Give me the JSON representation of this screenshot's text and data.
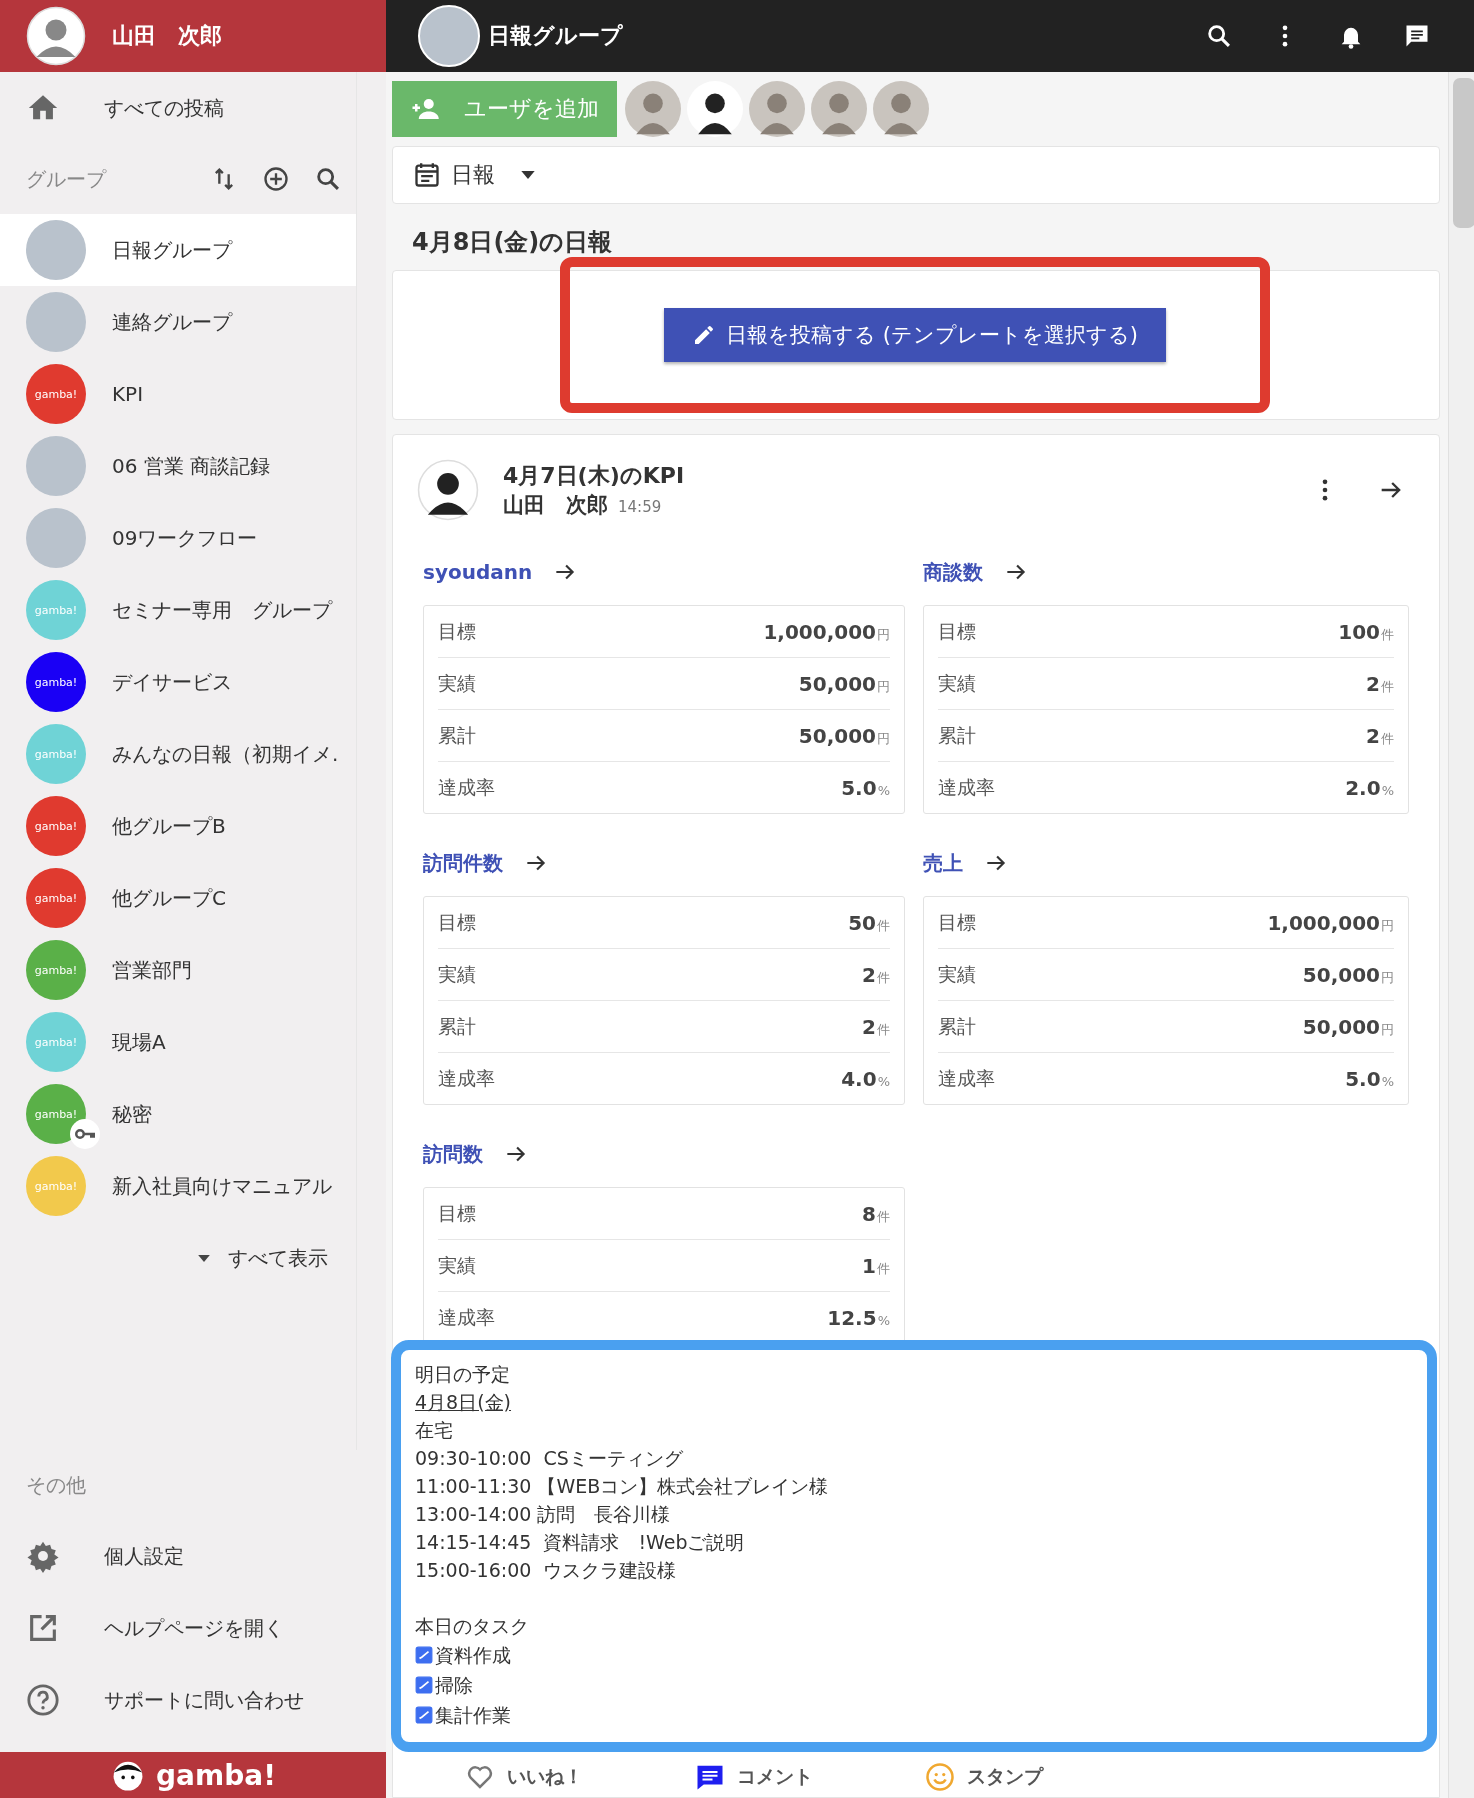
{
  "user": {
    "name": "山田　次郎"
  },
  "sidebar": {
    "all_posts": "すべての投稿",
    "groups_header": "グループ",
    "groups": [
      {
        "name": "日報グループ",
        "kind": "photo",
        "selected": true,
        "locked": false
      },
      {
        "name": "連絡グループ",
        "kind": "photo",
        "selected": false,
        "locked": false
      },
      {
        "name": "KPI",
        "kind": "logo",
        "logo": "gamba!",
        "color": "#e03a2f",
        "selected": false,
        "locked": false
      },
      {
        "name": "06 営業 商談記録",
        "kind": "photo",
        "selected": false,
        "locked": false
      },
      {
        "name": "09ワークフロー",
        "kind": "photo",
        "selected": false,
        "locked": false
      },
      {
        "name": "セミナー専用　グループ",
        "kind": "logo",
        "logo": "gamba!",
        "color": "#6fd3d6",
        "selected": false,
        "locked": false
      },
      {
        "name": "デイサービス",
        "kind": "logo",
        "logo": "gamba!",
        "color": "#1a00f5",
        "selected": false,
        "locked": false
      },
      {
        "name": "みんなの日報（初期イメ.",
        "kind": "logo",
        "logo": "gamba!",
        "color": "#6fd3d6",
        "selected": false,
        "locked": false
      },
      {
        "name": "他グループB",
        "kind": "logo",
        "logo": "gamba!",
        "color": "#e03a2f",
        "selected": false,
        "locked": false
      },
      {
        "name": "他グループC",
        "kind": "logo",
        "logo": "gamba!",
        "color": "#e03a2f",
        "selected": false,
        "locked": false
      },
      {
        "name": "営業部門",
        "kind": "logo",
        "logo": "gamba!",
        "color": "#5ab048",
        "selected": false,
        "locked": false
      },
      {
        "name": "現場A",
        "kind": "logo",
        "logo": "gamba!",
        "color": "#6fd3d6",
        "selected": false,
        "locked": false
      },
      {
        "name": "秘密",
        "kind": "logo",
        "logo": "gamba!",
        "color": "#5ab048",
        "selected": false,
        "locked": true
      },
      {
        "name": "新入社員向けマニュアル",
        "kind": "logo",
        "logo": "gamba!",
        "color": "#f2c94c",
        "selected": false,
        "locked": false
      }
    ],
    "show_all": "すべて表示",
    "other_header": "その他",
    "other_items": [
      {
        "label": "個人設定",
        "kind": "settings"
      },
      {
        "label": "ヘルプページを開く",
        "kind": "external"
      },
      {
        "label": "サポートに問い合わせ",
        "kind": "help"
      }
    ],
    "brand": "gamba!"
  },
  "topbar": {
    "title": "日報グループ"
  },
  "members": {
    "add_button": "ユーザを追加",
    "avatars": [
      {
        "kind": "photo"
      },
      {
        "kind": "cartoon"
      },
      {
        "kind": "photo"
      },
      {
        "kind": "photo"
      },
      {
        "kind": "photo"
      }
    ]
  },
  "filter": {
    "label": "日報"
  },
  "section_title": "4月8日(金)の日報",
  "post_button": "日報を投稿する (テンプレートを選択する)",
  "post": {
    "title": "4月7日(木)のKPI",
    "author": "山田　次郎",
    "time": "14:59",
    "kpis": [
      {
        "title": "syoudann",
        "rows": [
          {
            "label": "目標",
            "value": "1,000,000",
            "unit": "円"
          },
          {
            "label": "実績",
            "value": "50,000",
            "unit": "円"
          },
          {
            "label": "累計",
            "value": "50,000",
            "unit": "円"
          },
          {
            "label": "達成率",
            "value": "5.0",
            "unit": "%"
          }
        ]
      },
      {
        "title": "商談数",
        "rows": [
          {
            "label": "目標",
            "value": "100",
            "unit": "件"
          },
          {
            "label": "実績",
            "value": "2",
            "unit": "件"
          },
          {
            "label": "累計",
            "value": "2",
            "unit": "件"
          },
          {
            "label": "達成率",
            "value": "2.0",
            "unit": "%"
          }
        ]
      },
      {
        "title": "訪問件数",
        "rows": [
          {
            "label": "目標",
            "value": "50",
            "unit": "件"
          },
          {
            "label": "実績",
            "value": "2",
            "unit": "件"
          },
          {
            "label": "累計",
            "value": "2",
            "unit": "件"
          },
          {
            "label": "達成率",
            "value": "4.0",
            "unit": "%"
          }
        ]
      },
      {
        "title": "売上",
        "rows": [
          {
            "label": "目標",
            "value": "1,000,000",
            "unit": "円"
          },
          {
            "label": "実績",
            "value": "50,000",
            "unit": "円"
          },
          {
            "label": "累計",
            "value": "50,000",
            "unit": "円"
          },
          {
            "label": "達成率",
            "value": "5.0",
            "unit": "%"
          }
        ]
      },
      {
        "title": "訪問数",
        "rows": [
          {
            "label": "目標",
            "value": "8",
            "unit": "件"
          },
          {
            "label": "実績",
            "value": "1",
            "unit": "件"
          },
          {
            "label": "達成率",
            "value": "12.5",
            "unit": "%"
          }
        ]
      }
    ],
    "memo": [
      {
        "kind": "text",
        "text": "明日の予定"
      },
      {
        "kind": "date",
        "text": "4月8日(金)"
      },
      {
        "kind": "text",
        "text": "在宅"
      },
      {
        "kind": "text",
        "text": "09:30-10:00  CSミーティング"
      },
      {
        "kind": "text",
        "text": "11:00-11:30 【WEBコン】株式会社ブレイン様"
      },
      {
        "kind": "text",
        "text": "13:00-14:00 訪問　長谷川様"
      },
      {
        "kind": "text",
        "text": "14:15-14:45  資料請求　!Webご説明"
      },
      {
        "kind": "text",
        "text": "15:00-16:00  ウスクラ建設様"
      },
      {
        "kind": "blank"
      },
      {
        "kind": "text",
        "text": "本日のタスク"
      },
      {
        "kind": "task",
        "text": "資料作成",
        "checked": true
      },
      {
        "kind": "task",
        "text": "掃除",
        "checked": true
      },
      {
        "kind": "task",
        "text": "集計作業",
        "checked": true
      }
    ],
    "actions": [
      {
        "label": "いいね！",
        "kind": "like"
      },
      {
        "label": "コメント",
        "kind": "comment"
      },
      {
        "label": "スタンプ",
        "kind": "stamp"
      }
    ]
  }
}
